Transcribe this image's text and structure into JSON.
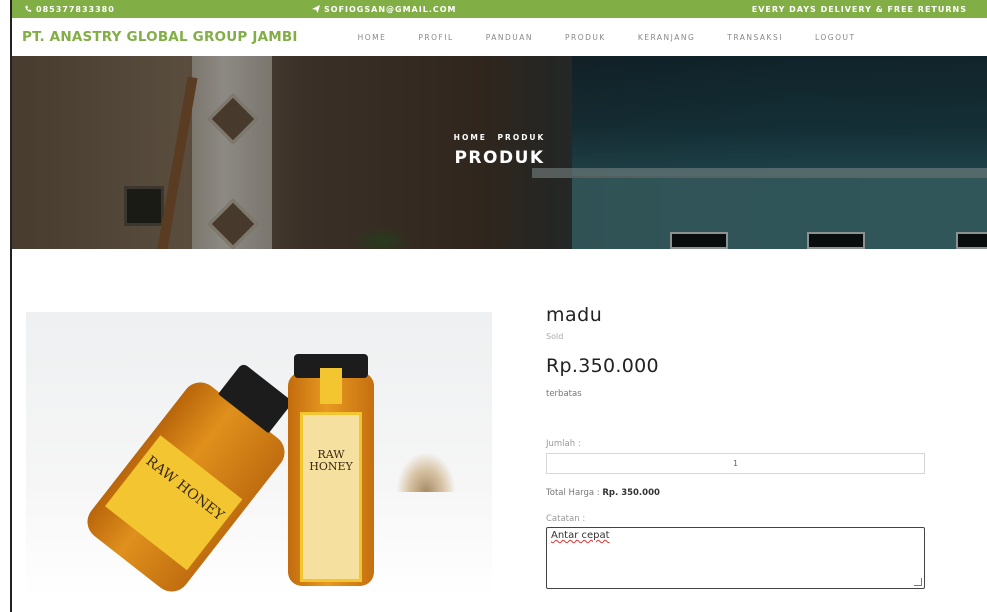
{
  "topbar": {
    "phone": "085377833380",
    "email": "SOFIOGSAN@GMAIL.COM",
    "delivery": "EVERY DAYS DELIVERY & FREE RETURNS"
  },
  "navbar": {
    "brand": "PT. ANASTRY GLOBAL GROUP JAMBI",
    "items": [
      "HOME",
      "PROFIL",
      "PANDUAN",
      "PRODUK",
      "KERANJANG",
      "TRANSAKSI",
      "LOGOUT"
    ]
  },
  "hero": {
    "breadcrumb": [
      "HOME",
      "PRODUK"
    ],
    "title": "PRODUK"
  },
  "product": {
    "name": "madu",
    "status": "Sold",
    "price": "Rp.350.000",
    "stock": "terbatas",
    "image_text_1": "RAW HONEY",
    "image_text_2": "RAW HONEY",
    "qty_label": "Jumlah :",
    "qty_value": "1",
    "total_label": "Total Harga : ",
    "total_value": "Rp. 350.000",
    "note_label": "Catatan :",
    "note_value": "Antar cepat"
  },
  "colors": {
    "accent": "#82ae46"
  }
}
